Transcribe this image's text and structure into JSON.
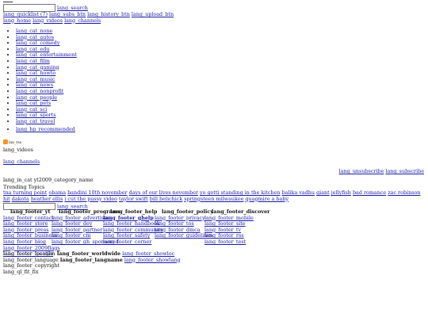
{
  "logo": "logo-mark",
  "search": {
    "button_label": "lang_search",
    "placeholder": ""
  },
  "nav_links": [
    "lang_quicklist (7)",
    "lang_subs_btn",
    "lang_history_btn",
    "lang_upload_btn"
  ],
  "nav_links2": [
    "lang_home",
    "lang_videos",
    "lang_channels"
  ],
  "categories": [
    "lang_cat_none",
    "lang_cat_autos",
    "lang_cat_comedy",
    "lang_cat_edu",
    "lang_cat_entertainment",
    "lang_cat_film",
    "lang_cat_gaming",
    "lang_cat_howto",
    "lang_cat_music",
    "lang_cat_news",
    "lang_cat_nonprofit",
    "lang_cat_people",
    "lang_cat_pets",
    "lang_cat_sci",
    "lang_cat_sports",
    "lang_cat_travel"
  ],
  "recommended": "lang_hp_recommended",
  "rss_label": "lan_rss",
  "videos_label": "lang_videos",
  "channels_label": "lang_channels",
  "unsubscribe": "lang_unsubscribe",
  "subscribe": "lang_subscribe",
  "category_name": "lang_in_cat yt2009_category_name",
  "trending_title": "Trending Topics",
  "trending_topics": [
    "tna turning point",
    "obama",
    "bandini 10th november",
    "days of our lives november",
    "yo gotti standing in the kitchen",
    "balika vadhu",
    "giant",
    "jellyfish",
    "bad romance",
    "zac robinson hit",
    "dakota",
    "heather ellis",
    "i cut the pussy video",
    "taylor swift",
    "bill belichick",
    "springsteen milwaukee",
    "quagmire a baby"
  ],
  "search2": {
    "button_label": "lang_search"
  },
  "footer": {
    "col1": {
      "head": "lang_footer_yt",
      "items": [
        "lang_footer_contact",
        "lang_footer_store",
        "lang_footer_press",
        "lang_footer_business",
        "lang_footer_blog",
        "lang_footer_2009flags",
        "lang_footer_ipsogle"
      ]
    },
    "col2": {
      "head": "lang_footer_programs",
      "items": [
        "lang_footer_advertising",
        "lang_footer_dev",
        "lang_footer_partner",
        "lang_footer_cm",
        "lang_footer_gh_sponsored"
      ]
    },
    "col3": {
      "head": "lang_footer_help",
      "items": [
        "lang_footer_ghelp",
        "lang_footer_handbook",
        "lang_footer_community",
        "lang_footer_safety",
        "lang_footer_corner"
      ]
    },
    "col4": {
      "head": "lang_footer_policy",
      "items": [
        "lang_footer_privacy",
        "lang_footer_tos",
        "lang_footer_dmca",
        "lang_footer_guidelines"
      ]
    },
    "col5": {
      "head": "lang_footer_discover",
      "items": [
        "lang_footer_mobile",
        "lang_footer_site",
        "lang_footer_tv",
        "lang_footer_rss",
        "lang_footer_test"
      ]
    },
    "location_label": "lang_footer_location",
    "location_value": "lang_footer_worldwide",
    "language_label": "lang_footer_language",
    "language_value": "lang_footer_langname",
    "showloc": "lang_footer_showloc",
    "showlang": "lang_footer_showlang",
    "copyright": "lang_footer_copyright",
    "ql_fit_fix": "lang_ql_fit_fix"
  }
}
